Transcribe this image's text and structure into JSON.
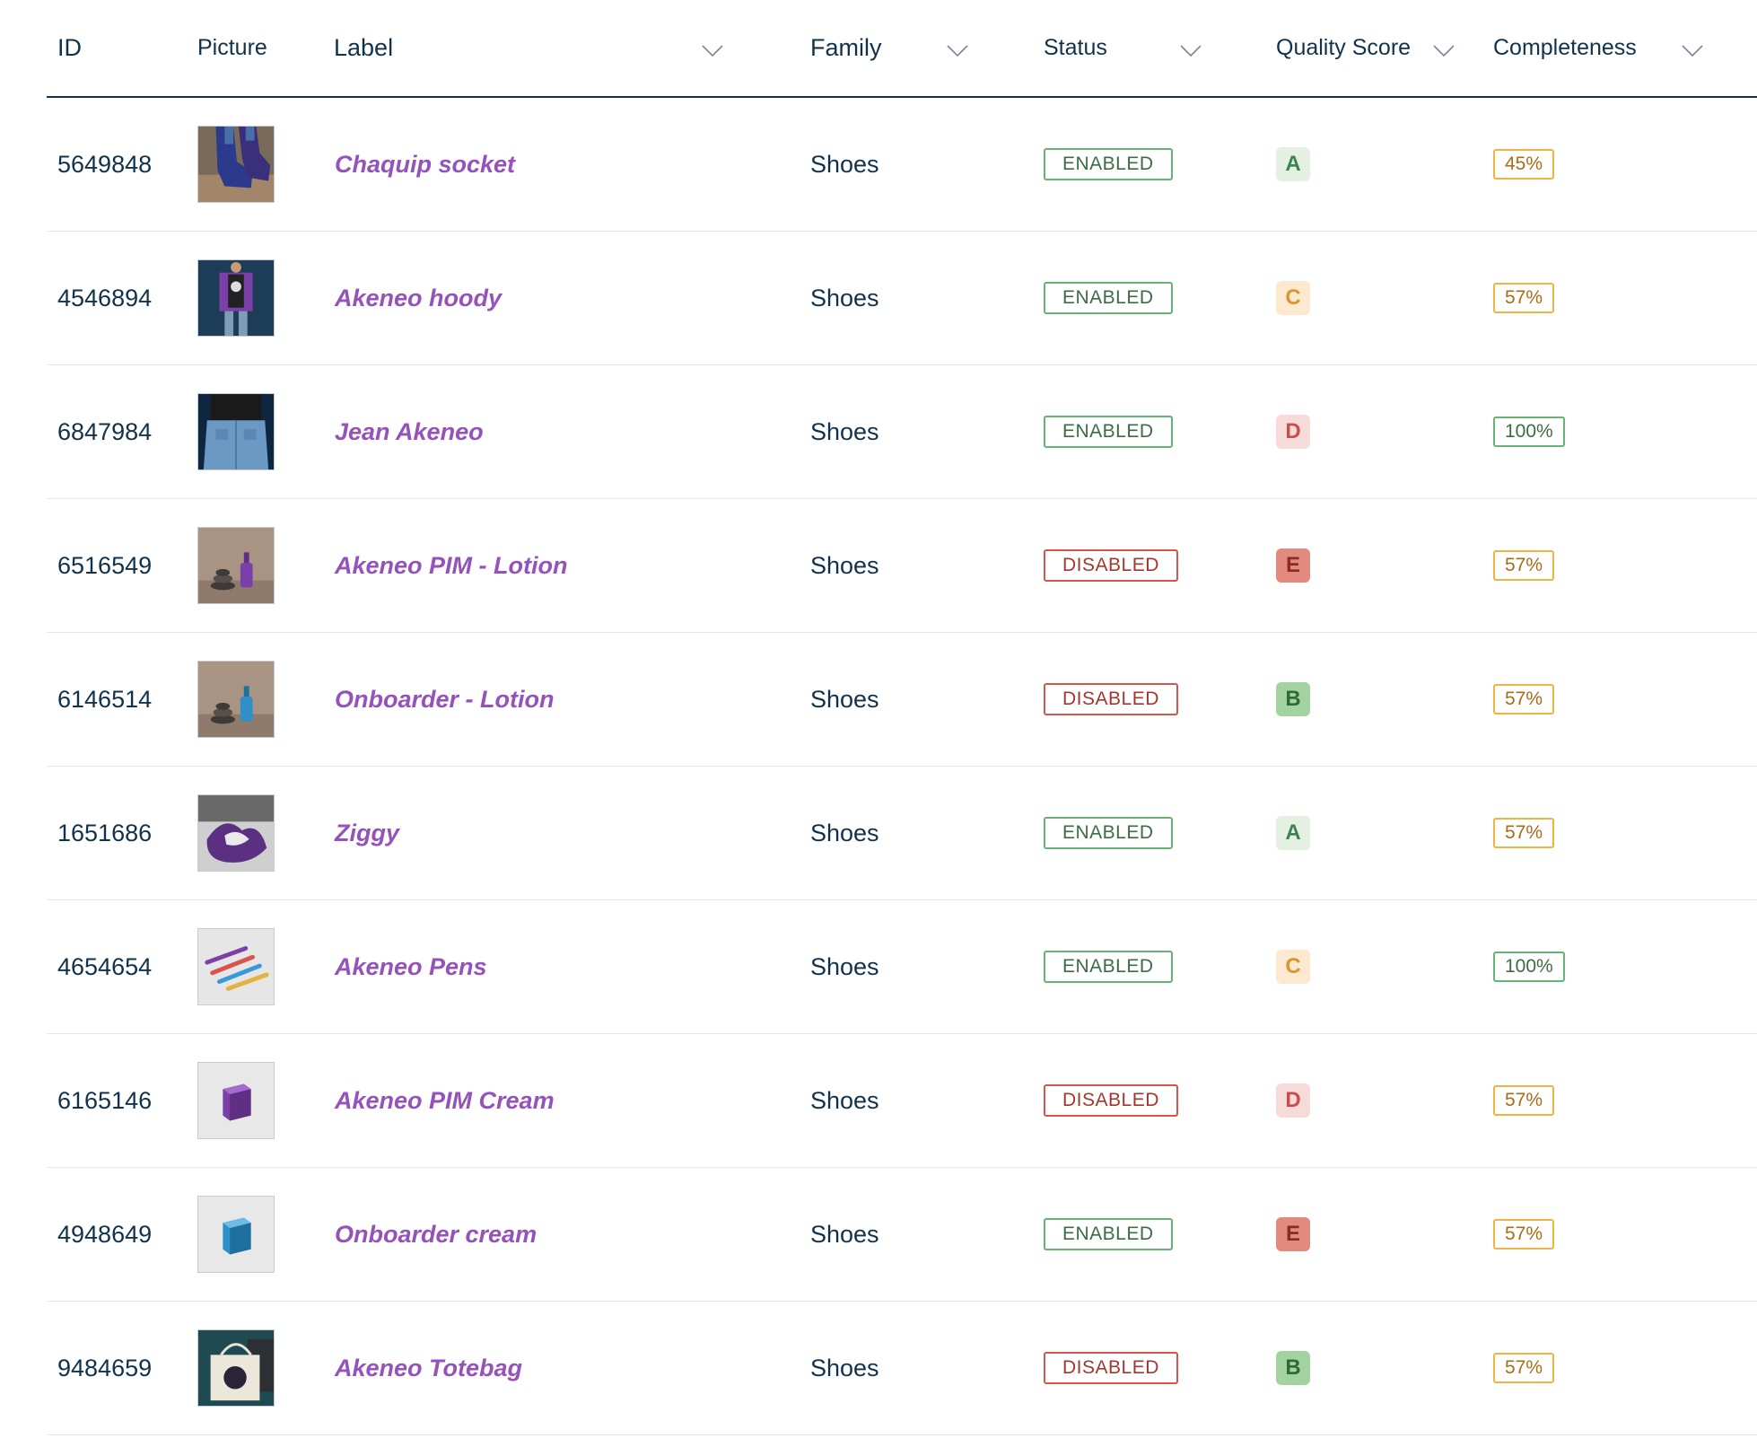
{
  "columns": {
    "id": "ID",
    "picture": "Picture",
    "label": "Label",
    "family": "Family",
    "status": "Status",
    "quality_score": "Quality Score",
    "completeness": "Completeness"
  },
  "rows": [
    {
      "id": "5649848",
      "label": "Chaquip socket",
      "family": "Shoes",
      "status": "ENABLED",
      "quality": "A",
      "completeness": "45%",
      "picture_icon": "socks-photo"
    },
    {
      "id": "4546894",
      "label": "Akeneo hoody",
      "family": "Shoes",
      "status": "ENABLED",
      "quality": "C",
      "completeness": "57%",
      "picture_icon": "hoody-photo"
    },
    {
      "id": "6847984",
      "label": "Jean Akeneo",
      "family": "Shoes",
      "status": "ENABLED",
      "quality": "D",
      "completeness": "100%",
      "picture_icon": "jeans-photo"
    },
    {
      "id": "6516549",
      "label": "Akeneo PIM - Lotion",
      "family": "Shoes",
      "status": "DISABLED",
      "quality": "E",
      "completeness": "57%",
      "picture_icon": "lotion-purple-photo"
    },
    {
      "id": "6146514",
      "label": "Onboarder - Lotion",
      "family": "Shoes",
      "status": "DISABLED",
      "quality": "B",
      "completeness": "57%",
      "picture_icon": "lotion-blue-photo"
    },
    {
      "id": "1651686",
      "label": "Ziggy",
      "family": "Shoes",
      "status": "ENABLED",
      "quality": "A",
      "completeness": "57%",
      "picture_icon": "plush-photo"
    },
    {
      "id": "4654654",
      "label": "Akeneo Pens",
      "family": "Shoes",
      "status": "ENABLED",
      "quality": "C",
      "completeness": "100%",
      "picture_icon": "pens-photo"
    },
    {
      "id": "6165146",
      "label": "Akeneo PIM Cream",
      "family": "Shoes",
      "status": "DISABLED",
      "quality": "D",
      "completeness": "57%",
      "picture_icon": "cream-purple-photo"
    },
    {
      "id": "4948649",
      "label": "Onboarder cream",
      "family": "Shoes",
      "status": "ENABLED",
      "quality": "E",
      "completeness": "57%",
      "picture_icon": "cream-blue-photo"
    },
    {
      "id": "9484659",
      "label": "Akeneo Totebag",
      "family": "Shoes",
      "status": "DISABLED",
      "quality": "B",
      "completeness": "57%",
      "picture_icon": "totebag-photo"
    }
  ],
  "colors": {
    "label": "#9452ba",
    "text": "#11324d",
    "enabled": "#67b373",
    "disabled": "#d4554a",
    "completeness_partial": "#f1b341",
    "completeness_full": "#67b373"
  }
}
